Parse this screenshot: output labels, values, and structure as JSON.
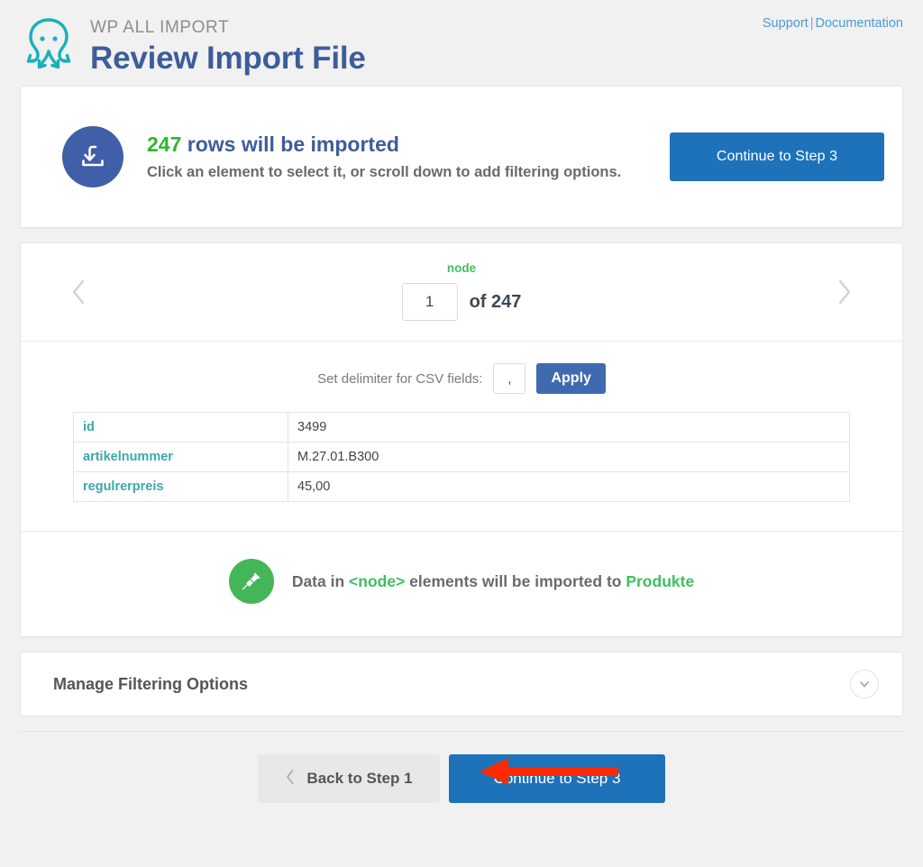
{
  "header": {
    "logo_icon": "octopus-logo-icon",
    "kicker": "WP ALL IMPORT",
    "title": "Review Import File",
    "support_link": "Support",
    "separator": "|",
    "documentation_link": "Documentation",
    "link_color": "#4a9bd4",
    "title_color": "#3e5c9a"
  },
  "summary": {
    "icon": "download-icon",
    "icon_bg": "#3f5fa8",
    "count": "247",
    "count_color": "#2fb62f",
    "headline_rest": " rows will be imported",
    "subtext": "Click an element to select it, or scroll down to add filtering options.",
    "continue_button": "Continue to Step 3",
    "continue_color": "#1d72ba"
  },
  "preview": {
    "node_label": "node",
    "node_label_color": "#3fbf5f",
    "prev_icon": "chevron-left-icon",
    "next_icon": "chevron-right-icon",
    "page_value": "1",
    "of_text": "of 247",
    "delimiter_label": "Set delimiter for CSV fields:",
    "delimiter_value": ",",
    "apply_button": "Apply",
    "apply_color": "#3f6ab0",
    "rows": [
      {
        "key": "id",
        "value": "3499"
      },
      {
        "key": "artikelnummer",
        "value": "M.27.01.B300"
      },
      {
        "key": "regulrerpreis",
        "value": "45,00"
      }
    ],
    "key_color": "#3aa8ae",
    "note": {
      "icon": "pin-icon",
      "icon_bg": "#45b657",
      "prefix": "Data in ",
      "element": "<node>",
      "middle": " elements will be imported to ",
      "target": "Produkte",
      "highlight_color": "#3fbf5f"
    }
  },
  "filtering": {
    "title": "Manage Filtering Options",
    "toggle_icon": "chevron-down-icon"
  },
  "footer": {
    "back_icon": "chevron-left-icon",
    "back_button": "Back to Step 1",
    "continue_button": "Continue to Step 3",
    "annotation_icon": "red-arrow-left-icon",
    "annotation_color": "#ff2a00"
  }
}
